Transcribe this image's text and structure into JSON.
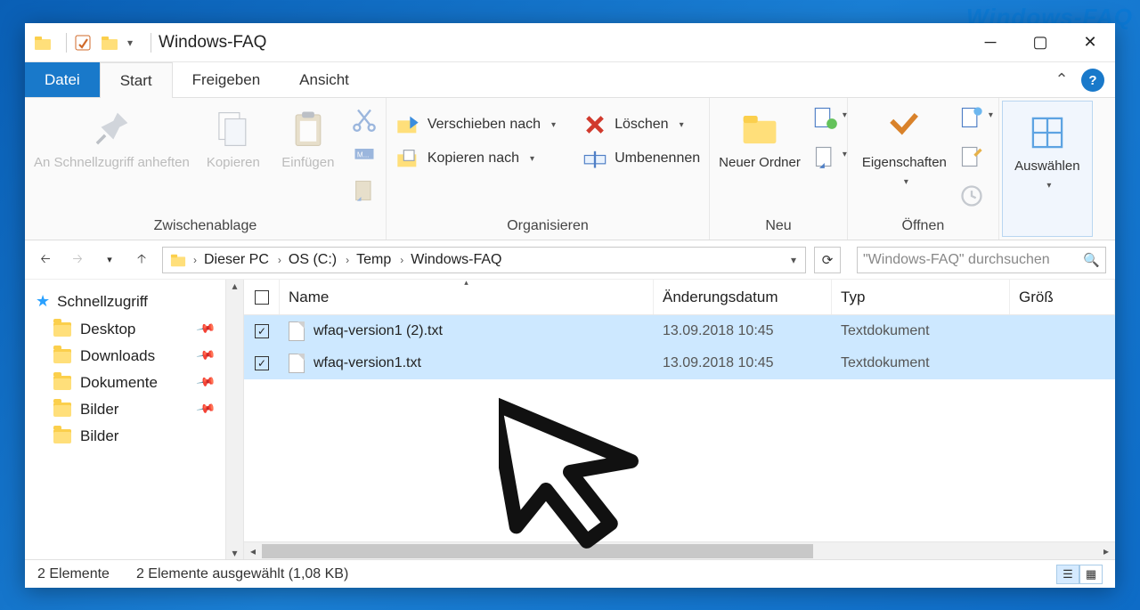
{
  "watermark": "Windows-FAQ",
  "title": "Windows-FAQ",
  "tabs": {
    "file": "Datei",
    "start": "Start",
    "share": "Freigeben",
    "view": "Ansicht"
  },
  "ribbon": {
    "clipboard": {
      "label": "Zwischenablage",
      "pin": "An Schnellzugriff anheften",
      "copy": "Kopieren",
      "paste": "Einfügen"
    },
    "organize": {
      "label": "Organisieren",
      "move_to": "Verschieben nach",
      "copy_to": "Kopieren nach",
      "delete": "Löschen",
      "rename": "Umbenennen"
    },
    "new": {
      "label": "Neu",
      "new_folder": "Neuer Ordner"
    },
    "open": {
      "label": "Öffnen",
      "properties": "Eigenschaften"
    },
    "select": {
      "label": "",
      "select": "Auswählen"
    }
  },
  "breadcrumb": [
    "Dieser PC",
    "OS (C:)",
    "Temp",
    "Windows-FAQ"
  ],
  "search_placeholder": "\"Windows-FAQ\" durchsuchen",
  "nav": {
    "quick_access": "Schnellzugriff",
    "items": [
      "Desktop",
      "Downloads",
      "Dokumente",
      "Bilder",
      "Bilder"
    ]
  },
  "columns": {
    "name": "Name",
    "date": "Änderungsdatum",
    "type": "Typ",
    "size": "Größ"
  },
  "files": [
    {
      "name": "wfaq-version1 (2).txt",
      "date": "13.09.2018 10:45",
      "type": "Textdokument",
      "checked": true
    },
    {
      "name": "wfaq-version1.txt",
      "date": "13.09.2018 10:45",
      "type": "Textdokument",
      "checked": true
    }
  ],
  "status": {
    "count": "2 Elemente",
    "selected": "2 Elemente ausgewählt (1,08 KB)"
  }
}
